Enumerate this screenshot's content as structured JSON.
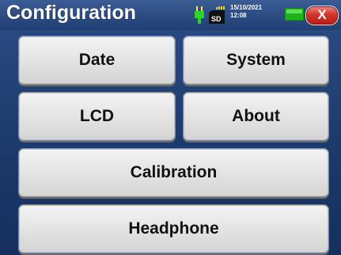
{
  "header": {
    "title": "Configuration",
    "status": {
      "date": "15/10/2021",
      "time": "12:08",
      "sd_label": "SD"
    },
    "close_label": "X"
  },
  "buttons": {
    "date": "Date",
    "system": "System",
    "lcd": "LCD",
    "about": "About",
    "calibration": "Calibration",
    "headphone": "Headphone"
  },
  "colors": {
    "accent_green": "#22c01e",
    "close_red": "#d2362b",
    "background_blue": "#1d3a6c"
  }
}
